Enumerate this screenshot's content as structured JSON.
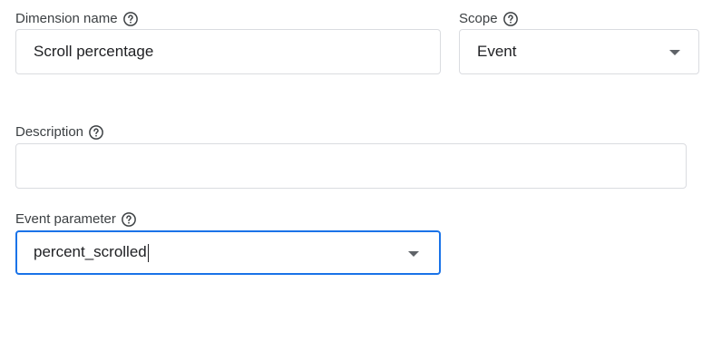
{
  "dimension_name": {
    "label": "Dimension name",
    "value": "Scroll percentage",
    "help_icon": "help-circle-icon"
  },
  "scope": {
    "label": "Scope",
    "selected": "Event",
    "help_icon": "help-circle-icon",
    "arrow_icon": "dropdown-arrow-icon"
  },
  "description": {
    "label": "Description",
    "value": "",
    "help_icon": "help-circle-icon"
  },
  "event_parameter": {
    "label": "Event parameter",
    "value": "percent_scrolled",
    "help_icon": "help-circle-icon",
    "arrow_icon": "dropdown-arrow-icon"
  },
  "colors": {
    "focus_border": "#1a73e8",
    "border": "#dadce0",
    "text": "#202124",
    "label": "#3c4043",
    "icon": "#5f6368"
  }
}
